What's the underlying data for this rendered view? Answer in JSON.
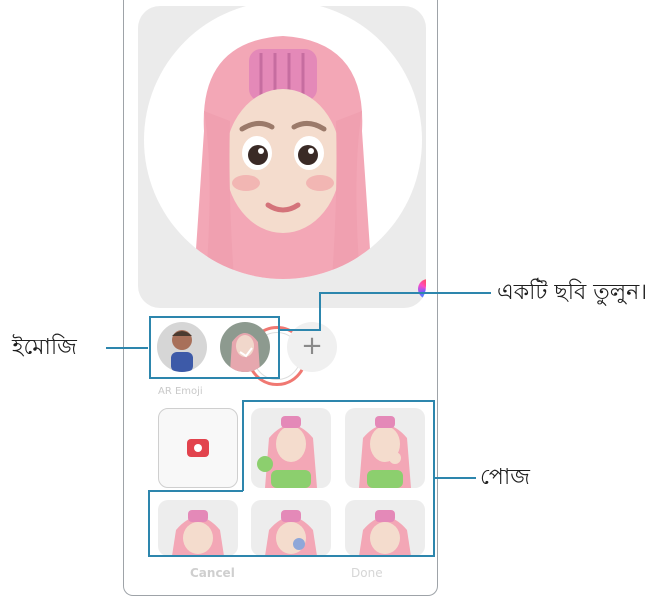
{
  "camera_screen": {
    "emoji_section_label": "AR Emoji",
    "add_emoji_label": "+",
    "cancel_label": "Cancel",
    "done_label": "Done"
  },
  "callouts": {
    "take_photo": "একটি ছবি তুলুন।",
    "emoji": "ইমোজি",
    "pose": "পোজ"
  },
  "colors": {
    "callout_line": "#2d86ad",
    "shutter_ring": "#f07872",
    "camera_icon": "#e2434d",
    "hair_pink": "#f3a7b6"
  }
}
